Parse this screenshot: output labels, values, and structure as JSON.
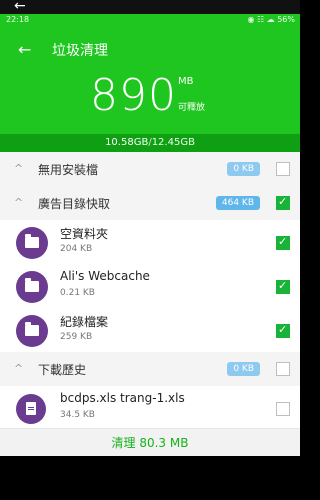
{
  "topbar": {
    "back_icon": "arrow-left-icon",
    "back_glyph": "←"
  },
  "status": {
    "time": "22:18",
    "icons_text": "◉ ☷ ☁ 56%"
  },
  "header": {
    "back_glyph": "←",
    "title": "垃圾清理",
    "big_number": "890",
    "unit": "MB",
    "note": "可釋放"
  },
  "storage": {
    "used": "10.58GB",
    "sep": "/",
    "total": "12.45GB"
  },
  "sections": [
    {
      "label": "無用安裝檔",
      "badge": "0 KB",
      "checked": false,
      "chevron": "^"
    },
    {
      "label": "廣告目錄快取",
      "badge": "464 KB",
      "checked": true,
      "chevron": "^"
    },
    {
      "label": "下載歷史",
      "badge": "0 KB",
      "checked": false,
      "chevron": "^"
    }
  ],
  "ad_cache_items": [
    {
      "name": "空資料夾",
      "size": "204 KB",
      "checked": true
    },
    {
      "name": "Ali's Webcache",
      "size": "0.21 KB",
      "checked": true
    },
    {
      "name": "紀錄檔案",
      "size": "259 KB",
      "checked": true
    }
  ],
  "download_items": [
    {
      "name": "bcdps.xls trang-1.xls",
      "size": "34.5 KB",
      "checked": false
    }
  ],
  "clean_button": "清理 80.3 MB",
  "colors": {
    "accent_green": "#1fc61f",
    "dark_green": "#0f9f12",
    "purple_icon": "#6a3b8f",
    "badge_blue": "#8ec9ef",
    "check_green": "#18b43a"
  }
}
